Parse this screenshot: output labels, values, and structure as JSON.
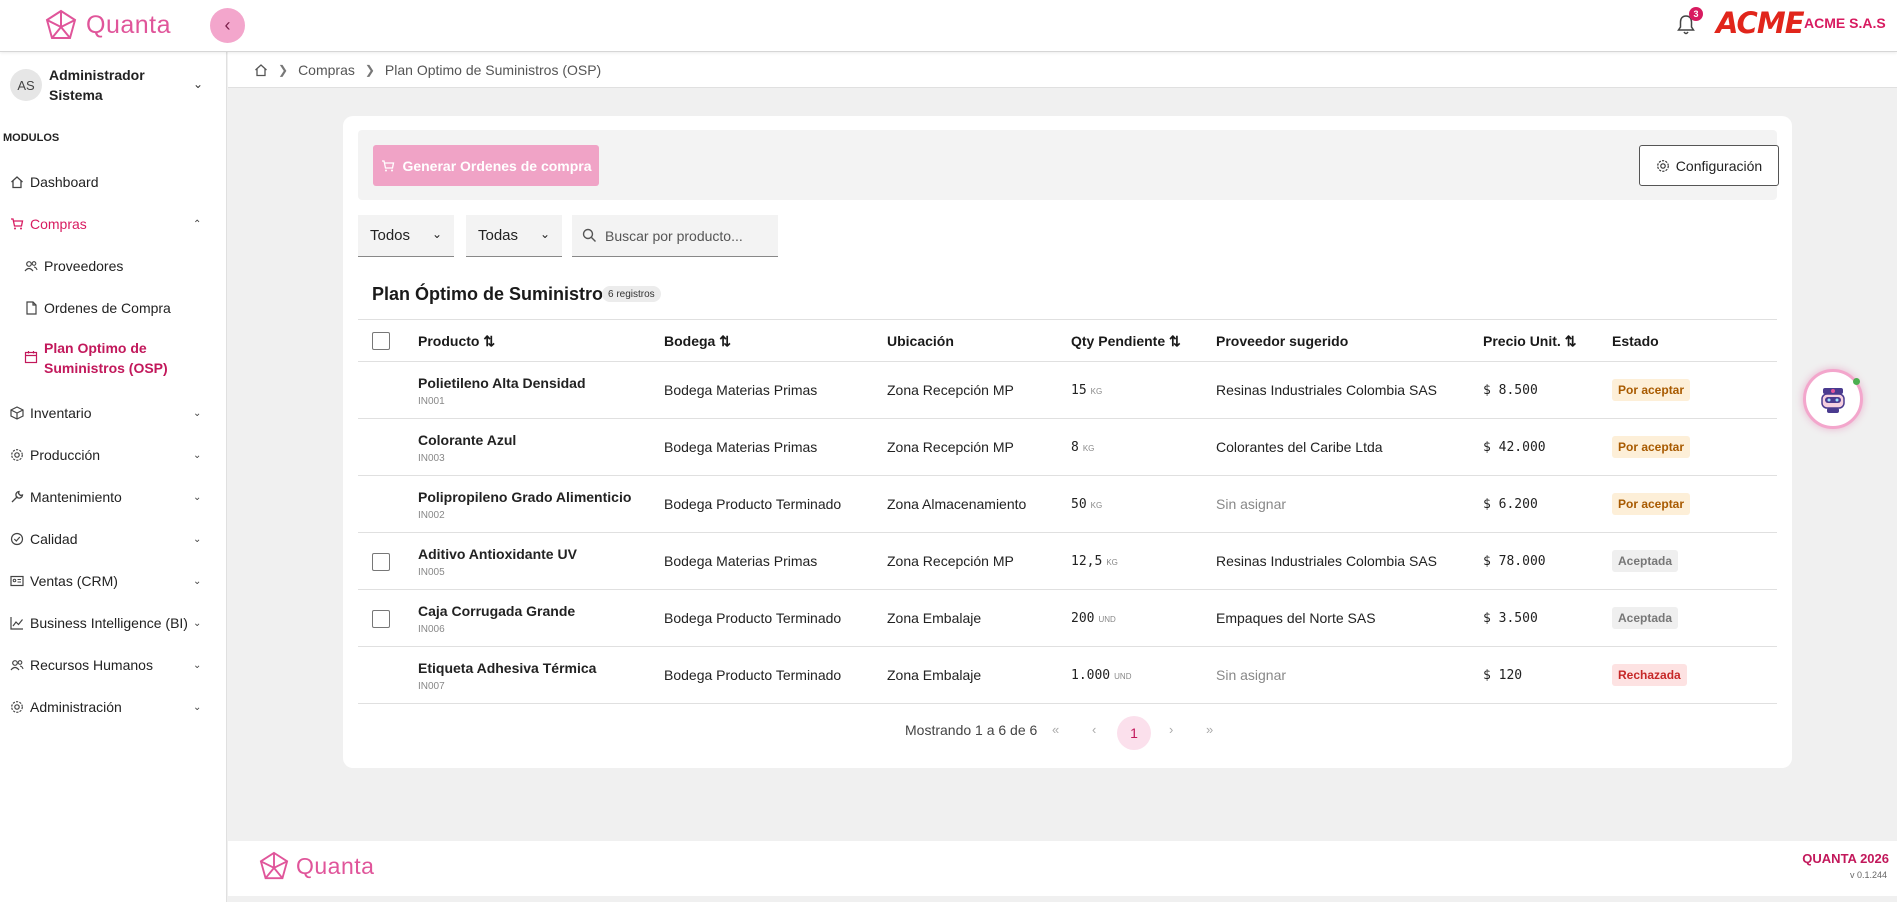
{
  "header": {
    "app_name": "Quanta",
    "notifications_count": "3",
    "client_logo_text": "ACME",
    "company_name": "ACME S.A.S"
  },
  "user": {
    "initials": "AS",
    "name": "Administrador Sistema"
  },
  "sidebar": {
    "section_label": "MODULOS",
    "items": [
      {
        "label": "Dashboard",
        "icon": "home-icon"
      },
      {
        "label": "Compras",
        "icon": "cart-icon"
      },
      {
        "label": "Proveedores",
        "icon": "users-icon"
      },
      {
        "label": "Ordenes de Compra",
        "icon": "document-icon"
      },
      {
        "label": "Plan Optimo de Suministros (OSP)",
        "icon": "calendar-icon"
      },
      {
        "label": "Inventario",
        "icon": "box-icon"
      },
      {
        "label": "Producción",
        "icon": "gear-icon"
      },
      {
        "label": "Mantenimiento",
        "icon": "wrench-icon"
      },
      {
        "label": "Calidad",
        "icon": "check-circle-icon"
      },
      {
        "label": "Ventas (CRM)",
        "icon": "id-card-icon"
      },
      {
        "label": "Business Intelligence (BI)",
        "icon": "chart-line-icon"
      },
      {
        "label": "Recursos Humanos",
        "icon": "users-icon"
      },
      {
        "label": "Administración",
        "icon": "gear-icon"
      }
    ]
  },
  "breadcrumb": {
    "items": [
      "Compras",
      "Plan Optimo de Suministros (OSP)"
    ]
  },
  "toolbar": {
    "generate_label": "Generar Ordenes de compra",
    "config_label": "Configuración"
  },
  "filters": {
    "filter1_value": "Todos",
    "filter2_value": "Todas",
    "search_placeholder": "Buscar por producto..."
  },
  "table": {
    "title": "Plan Óptimo de Suministros",
    "count_label": "6 registros",
    "columns": [
      "Producto",
      "Bodega",
      "Ubicación",
      "Qty Pendiente",
      "Proveedor sugerido",
      "Precio Unit.",
      "Estado"
    ],
    "rows": [
      {
        "name": "Polietileno Alta Densidad",
        "code": "IN001",
        "bodega": "Bodega Materias Primas",
        "ubicacion": "Zona Recepción MP",
        "qty": "15",
        "unit": "KG",
        "proveedor": "Resinas Industriales Colombia SAS",
        "precio": "$ 8.500",
        "estado": "Por aceptar"
      },
      {
        "name": "Colorante Azul",
        "code": "IN003",
        "bodega": "Bodega Materias Primas",
        "ubicacion": "Zona Recepción MP",
        "qty": "8",
        "unit": "KG",
        "proveedor": "Colorantes del Caribe Ltda",
        "precio": "$ 42.000",
        "estado": "Por aceptar"
      },
      {
        "name": "Polipropileno Grado Alimenticio",
        "code": "IN002",
        "bodega": "Bodega Producto Terminado",
        "ubicacion": "Zona Almacenamiento",
        "qty": "50",
        "unit": "KG",
        "proveedor": "Sin asignar",
        "precio": "$ 6.200",
        "estado": "Por aceptar"
      },
      {
        "name": "Aditivo Antioxidante UV",
        "code": "IN005",
        "bodega": "Bodega Materias Primas",
        "ubicacion": "Zona Recepción MP",
        "qty": "12,5",
        "unit": "KG",
        "proveedor": "Resinas Industriales Colombia SAS",
        "precio": "$ 78.000",
        "estado": "Aceptada"
      },
      {
        "name": "Caja Corrugada Grande",
        "code": "IN006",
        "bodega": "Bodega Producto Terminado",
        "ubicacion": "Zona Embalaje",
        "qty": "200",
        "unit": "UND",
        "proveedor": "Empaques del Norte SAS",
        "precio": "$ 3.500",
        "estado": "Aceptada"
      },
      {
        "name": "Etiqueta Adhesiva Térmica",
        "code": "IN007",
        "bodega": "Bodega Producto Terminado",
        "ubicacion": "Zona Embalaje",
        "qty": "1.000",
        "unit": "UND",
        "proveedor": "Sin asignar",
        "precio": "$ 120",
        "estado": "Rechazada"
      }
    ]
  },
  "pagination": {
    "summary": "Mostrando 1 a 6 de 6",
    "current_page": "1"
  },
  "footer": {
    "brand": "QUANTA 2026",
    "version": "v 0.1.244"
  },
  "colors": {
    "brand": "#e0559a",
    "accent": "#d81b60"
  }
}
